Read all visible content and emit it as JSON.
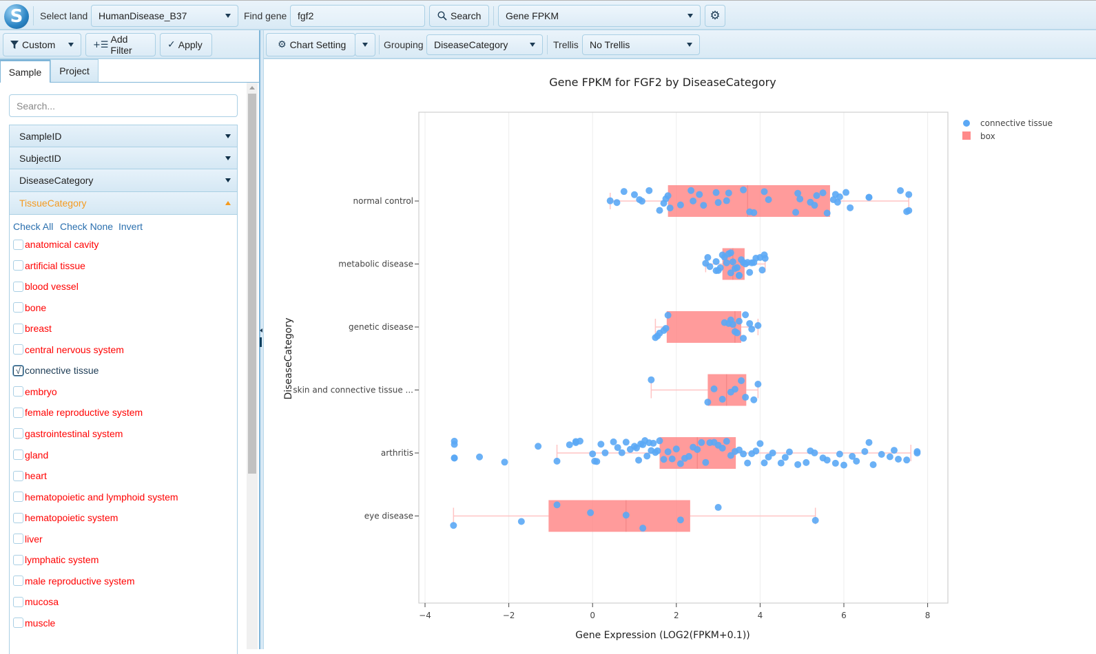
{
  "topbar": {
    "logo_letter": "S",
    "select_land_label": "Select land",
    "land_value": "HumanDisease_B37",
    "find_gene_label": "Find gene",
    "gene_value": "fgf2",
    "search_label": "Search",
    "measure_value": "Gene FPKM"
  },
  "toolbar_left": {
    "custom_label": "Custom",
    "add_filter_label": "Add Filter",
    "apply_label": "Apply"
  },
  "toolbar_right": {
    "chart_setting_label": "Chart Setting",
    "grouping_label": "Grouping",
    "grouping_value": "DiseaseCategory",
    "trellis_label": "Trellis",
    "trellis_value": "No Trellis"
  },
  "left_panel": {
    "tabs": [
      {
        "label": "Sample",
        "active": true
      },
      {
        "label": "Project",
        "active": false
      }
    ],
    "search_placeholder": "Search...",
    "accordions": [
      {
        "label": "SampleID",
        "expanded": false
      },
      {
        "label": "SubjectID",
        "expanded": false
      },
      {
        "label": "DiseaseCategory",
        "expanded": false
      },
      {
        "label": "TissueCategory",
        "expanded": true
      }
    ],
    "actions": [
      "Check All",
      "Check None",
      "Invert"
    ],
    "tissue_items": [
      {
        "label": "anatomical cavity",
        "checked": false
      },
      {
        "label": "artificial tissue",
        "checked": false
      },
      {
        "label": "blood vessel",
        "checked": false
      },
      {
        "label": "bone",
        "checked": false
      },
      {
        "label": "breast",
        "checked": false
      },
      {
        "label": "central nervous system",
        "checked": false
      },
      {
        "label": "connective tissue",
        "checked": true
      },
      {
        "label": "embryo",
        "checked": false
      },
      {
        "label": "female reproductive system",
        "checked": false
      },
      {
        "label": "gastrointestinal system",
        "checked": false
      },
      {
        "label": "gland",
        "checked": false
      },
      {
        "label": "heart",
        "checked": false
      },
      {
        "label": "hematopoietic and lymphoid system",
        "checked": false
      },
      {
        "label": "hematopoietic system",
        "checked": false
      },
      {
        "label": "liver",
        "checked": false
      },
      {
        "label": "lymphatic system",
        "checked": false
      },
      {
        "label": "male reproductive system",
        "checked": false
      },
      {
        "label": "mucosa",
        "checked": false
      },
      {
        "label": "muscle",
        "checked": false
      }
    ]
  },
  "colors": {
    "point": "#5ba8f5",
    "box": "#ff8a8a",
    "checked_text": "#1d3c55",
    "unchecked_text": "#ff0000",
    "accent_orange": "#f59a1f"
  },
  "chart_data": {
    "type": "box",
    "title": "Gene FPKM for FGF2 by DiseaseCategory",
    "xlabel": "Gene Expression (LOG2(FPKM+0.1))",
    "ylabel": "DiseaseCategory",
    "xlim": [
      -4.1,
      8.5
    ],
    "xticks": [
      -4,
      -2,
      0,
      2,
      4,
      6,
      8
    ],
    "xtick_labels": [
      "−4",
      "−2",
      "0",
      "2",
      "4",
      "6",
      "8"
    ],
    "grid": true,
    "legend_position": "top-right",
    "legend": [
      {
        "name": "connective tissue",
        "type": "point"
      },
      {
        "name": "box",
        "type": "box"
      }
    ],
    "categories": [
      "normal control",
      "metabolic disease",
      "genetic disease",
      "skin and connective tissue ...",
      "arthritis",
      "eye disease"
    ],
    "boxes": [
      {
        "category": "normal control",
        "whisker_low": 0.42,
        "q1": 1.8,
        "median": 3.7,
        "q3": 5.67,
        "whisker_high": 7.55
      },
      {
        "category": "metabolic disease",
        "whisker_low": 2.7,
        "q1": 3.1,
        "median": 3.35,
        "q3": 3.63,
        "whisker_high": 4.12
      },
      {
        "category": "genetic disease",
        "whisker_low": 1.5,
        "q1": 1.77,
        "median": 3.4,
        "q3": 3.55,
        "whisker_high": 3.95
      },
      {
        "category": "skin and connective tissue ...",
        "whisker_low": 1.4,
        "q1": 2.75,
        "median": 3.2,
        "q3": 3.67,
        "whisker_high": 3.95
      },
      {
        "category": "arthritis",
        "whisker_low": -0.85,
        "q1": 1.6,
        "median": 2.5,
        "q3": 3.42,
        "whisker_high": 7.6
      },
      {
        "category": "eye disease",
        "whisker_low": -3.32,
        "q1": -1.05,
        "median": 0.8,
        "q3": 2.33,
        "whisker_high": 5.32
      }
    ],
    "points": {
      "normal control": [
        0.42,
        0.58,
        0.75,
        1.0,
        1.12,
        1.18,
        1.35,
        1.6,
        1.7,
        1.75,
        1.8,
        1.85,
        2.1,
        2.35,
        2.4,
        2.55,
        2.65,
        2.95,
        3.0,
        3.2,
        3.25,
        3.6,
        3.75,
        3.85,
        4.1,
        4.2,
        4.85,
        4.9,
        4.95,
        5.2,
        5.3,
        5.35,
        5.5,
        5.6,
        5.75,
        5.8,
        5.85,
        5.9,
        6.05,
        6.15,
        6.6,
        6.6,
        7.35,
        7.5,
        7.55,
        7.55
      ],
      "metabolic disease": [
        2.7,
        2.75,
        2.8,
        2.95,
        3.0,
        3.05,
        3.1,
        3.15,
        3.2,
        3.25,
        3.3,
        3.35,
        3.4,
        3.45,
        3.5,
        3.55,
        3.6,
        3.65,
        3.7,
        3.75,
        3.8,
        3.85,
        3.9,
        4.0,
        4.05,
        4.1,
        4.12,
        2.95,
        3.3,
        3.5
      ],
      "genetic disease": [
        1.5,
        1.55,
        1.6,
        1.7,
        1.75,
        1.8,
        3.15,
        3.25,
        3.3,
        3.35,
        3.4,
        3.45,
        3.5,
        3.6,
        3.65,
        3.75,
        3.8,
        3.95
      ],
      "skin and connective tissue ...": [
        1.4,
        2.75,
        2.9,
        3.1,
        3.3,
        3.4,
        3.55,
        3.65,
        3.85,
        3.95
      ],
      "arthritis": [
        -3.3,
        -3.3,
        -3.3,
        -3.3,
        -2.7,
        -2.1,
        -1.3,
        -0.85,
        -0.55,
        -0.4,
        -0.4,
        -0.3,
        0.0,
        0.05,
        0.1,
        0.2,
        0.3,
        0.5,
        0.6,
        0.7,
        0.8,
        0.9,
        1.0,
        1.05,
        1.1,
        1.15,
        1.2,
        1.25,
        1.3,
        1.35,
        1.4,
        1.45,
        1.5,
        1.55,
        1.6,
        1.7,
        1.8,
        1.9,
        2.0,
        2.1,
        2.2,
        2.3,
        2.4,
        2.5,
        2.6,
        2.7,
        2.8,
        2.9,
        3.0,
        3.1,
        3.2,
        3.3,
        3.4,
        3.5,
        3.6,
        3.7,
        3.8,
        3.9,
        4.0,
        4.1,
        4.2,
        4.3,
        4.5,
        4.6,
        4.7,
        4.9,
        5.1,
        5.2,
        5.3,
        5.5,
        5.6,
        5.8,
        5.9,
        6.0,
        6.2,
        6.3,
        6.5,
        6.6,
        6.7,
        6.9,
        7.1,
        7.2,
        7.3,
        7.5,
        7.75,
        7.75
      ],
      "eye disease": [
        -3.32,
        -1.7,
        -0.85,
        -0.05,
        0.8,
        1.2,
        2.1,
        3.0,
        5.32
      ]
    }
  }
}
